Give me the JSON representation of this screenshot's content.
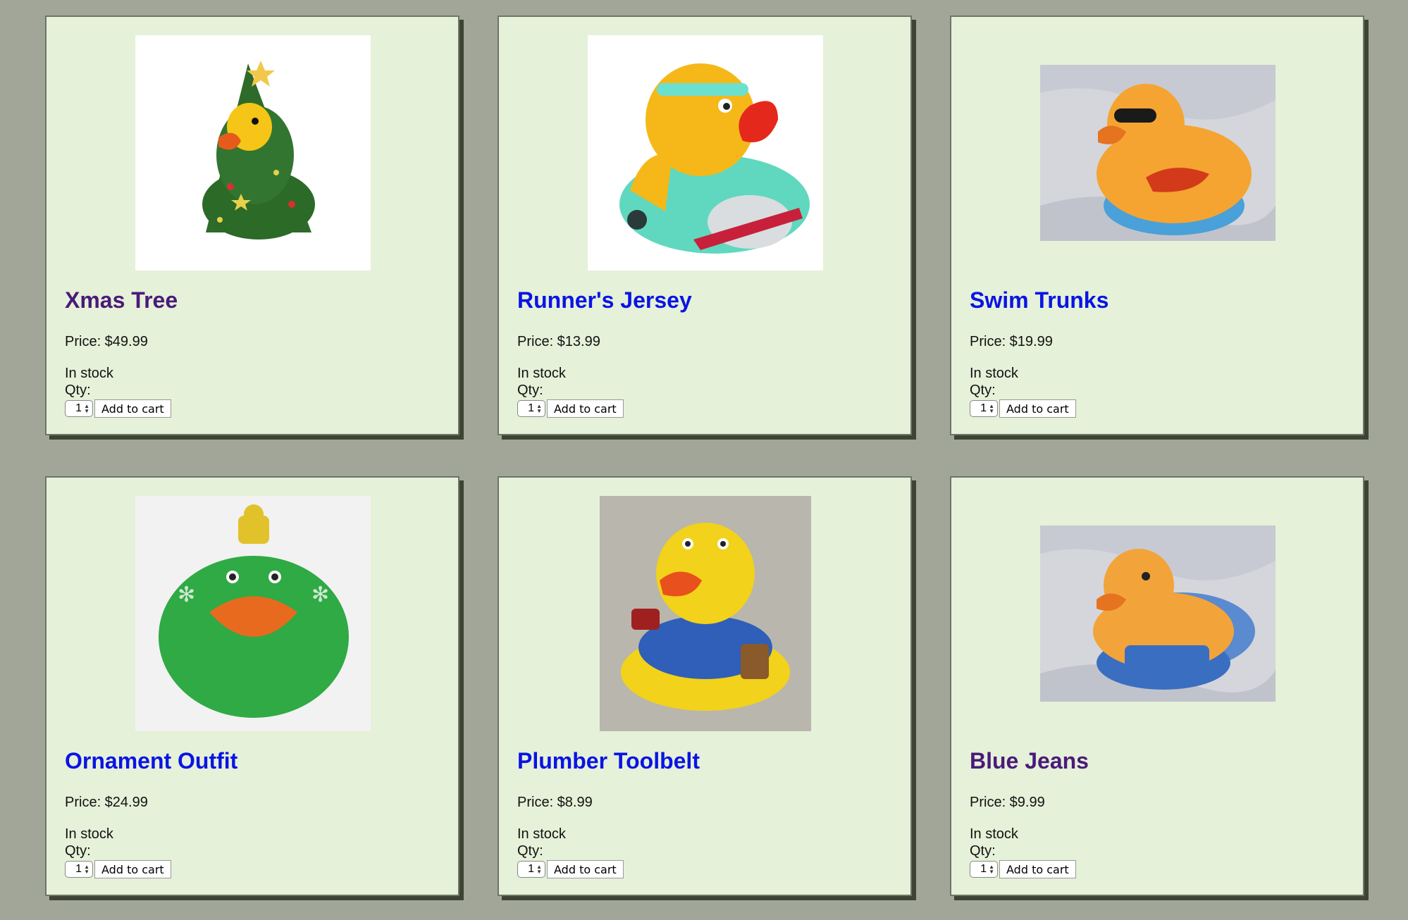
{
  "products": [
    {
      "name": "Xmas Tree",
      "price": "Price: $49.99",
      "stock": "In stock",
      "qty_label": "Qty:",
      "qty": "1",
      "button": "Add to cart",
      "link_state": "visited"
    },
    {
      "name": "Runner's Jersey",
      "price": "Price: $13.99",
      "stock": "In stock",
      "qty_label": "Qty:",
      "qty": "1",
      "button": "Add to cart",
      "link_state": "unvisited"
    },
    {
      "name": "Swim Trunks",
      "price": "Price: $19.99",
      "stock": "In stock",
      "qty_label": "Qty:",
      "qty": "1",
      "button": "Add to cart",
      "link_state": "unvisited"
    },
    {
      "name": "Ornament Outfit",
      "price": "Price: $24.99",
      "stock": "In stock",
      "qty_label": "Qty:",
      "qty": "1",
      "button": "Add to cart",
      "link_state": "unvisited"
    },
    {
      "name": "Plumber Toolbelt",
      "price": "Price: $8.99",
      "stock": "In stock",
      "qty_label": "Qty:",
      "qty": "1",
      "button": "Add to cart",
      "link_state": "unvisited"
    },
    {
      "name": "Blue Jeans",
      "price": "Price: $9.99",
      "stock": "In stock",
      "qty_label": "Qty:",
      "qty": "1",
      "button": "Add to cart",
      "link_state": "visited"
    }
  ],
  "colors": {
    "page_bg": "#a1a698",
    "card_bg": "#e5f1d8",
    "card_shadow": "#3d4433",
    "link_visited": "#4a1a7a",
    "link_unvisited": "#0a14e4"
  }
}
